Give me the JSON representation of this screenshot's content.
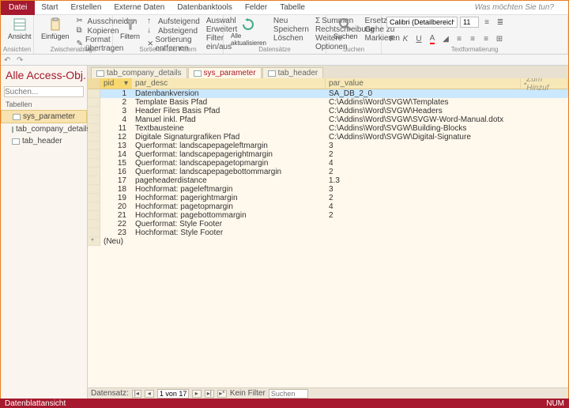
{
  "ribbon": {
    "file": "Datei",
    "tabs": [
      "Start",
      "Erstellen",
      "Externe Daten",
      "Datenbanktools",
      "Felder",
      "Tabelle"
    ],
    "hint": "Was möchten Sie tun?",
    "groups": {
      "views": {
        "label": "Ansichten",
        "view_btn": "Ansicht"
      },
      "clipboard": {
        "label": "Zwischenablage",
        "paste": "Einfügen",
        "cut": "Ausschneiden",
        "copy": "Kopieren",
        "format": "Format übertragen"
      },
      "sortfilter": {
        "label": "Sortieren und Filtern",
        "filter": "Filtern",
        "asc": "Aufsteigend",
        "desc": "Absteigend",
        "remove": "Sortierung entfernen",
        "sel": "Auswahl",
        "adv": "Erweitert",
        "toggle": "Filter ein/aus"
      },
      "records": {
        "label": "Datensätze",
        "refresh": "Alle aktualisieren",
        "new": "Neu",
        "save": "Speichern",
        "delete": "Löschen",
        "sum": "Summen",
        "spelling": "Rechtschreibung",
        "more": "Weitere Optionen"
      },
      "find": {
        "label": "Suchen",
        "find": "Suchen",
        "replace": "Ersetzen",
        "goto": "Gehe zu",
        "select": "Markieren"
      },
      "format": {
        "label": "Textformatierung",
        "font": "Calibri (Detailbereich)",
        "size": "11"
      }
    }
  },
  "nav": {
    "title": "Alle Access-Obj...",
    "search_ph": "Suchen...",
    "section": "Tabellen",
    "items": [
      "sys_parameter",
      "tab_company_details",
      "tab_header"
    ]
  },
  "tabs": [
    "tab_company_details",
    "sys_parameter",
    "tab_header"
  ],
  "grid": {
    "headers": {
      "pid": "pid",
      "desc": "par_desc",
      "val": "par_value",
      "add": "Zum Hinzuf"
    },
    "rows": [
      {
        "pid": "1",
        "desc": "Datenbankversion",
        "val": "SA_DB_2_0"
      },
      {
        "pid": "2",
        "desc": "Template Basis Pfad",
        "val": "C:\\Addins\\Word\\SVGW\\Templates"
      },
      {
        "pid": "3",
        "desc": "Header Files Basis Pfad",
        "val": "C:\\Addins\\Word\\SVGW\\Headers"
      },
      {
        "pid": "4",
        "desc": "Manuel inkl. Pfad",
        "val": "C:\\Addins\\Word\\SVGW\\SVGW-Word-Manual.dotx"
      },
      {
        "pid": "11",
        "desc": "Textbausteine",
        "val": "C:\\Addins\\Word\\SVGW\\Building-Blocks"
      },
      {
        "pid": "12",
        "desc": "Digitale Signaturgrafiken Pfad",
        "val": "C:\\Addins\\Word\\SVGW\\Digital-Signature"
      },
      {
        "pid": "13",
        "desc": "Querformat: landscapepageleftmargin",
        "val": "3"
      },
      {
        "pid": "14",
        "desc": "Querformat: landscapepagerightmargin",
        "val": "2"
      },
      {
        "pid": "15",
        "desc": "Querformat: landscapepagetopmargin",
        "val": "4"
      },
      {
        "pid": "16",
        "desc": "Querformat: landscapepagebottommargin",
        "val": "2"
      },
      {
        "pid": "17",
        "desc": "pageheaderdistance",
        "val": "1.3"
      },
      {
        "pid": "18",
        "desc": "Hochformat: pageleftmargin",
        "val": "3"
      },
      {
        "pid": "19",
        "desc": "Hochformat: pagerightmargin",
        "val": "2"
      },
      {
        "pid": "20",
        "desc": "Hochformat: pagetopmargin",
        "val": "4"
      },
      {
        "pid": "21",
        "desc": "Hochformat: pagebottommargin",
        "val": "2"
      },
      {
        "pid": "22",
        "desc": "Querformat: Style Footer",
        "val": ""
      },
      {
        "pid": "23",
        "desc": "Hochformat: Style Footer",
        "val": ""
      }
    ],
    "new_row": "(Neu)"
  },
  "recnav": {
    "label": "Datensatz:",
    "pos": "1 von 17",
    "nofilter": "Kein Filter",
    "search": "Suchen"
  },
  "status": {
    "left": "Datenblattansicht",
    "right": "NUM"
  }
}
